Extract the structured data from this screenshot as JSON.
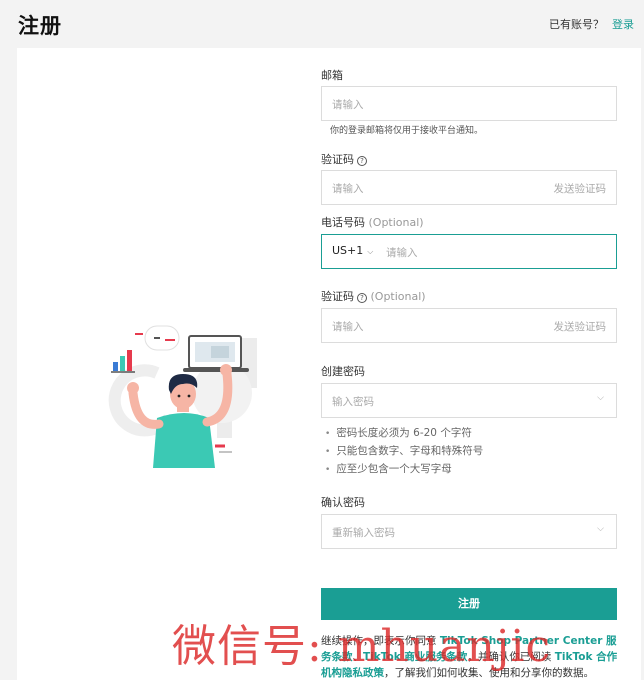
{
  "header": {
    "title": "注册",
    "has_account": "已有账号？",
    "login": "登录"
  },
  "form": {
    "email": {
      "label": "邮箱",
      "placeholder": "请输入",
      "hint": "你的登录邮箱将仅用于接收平台通知。"
    },
    "email_code": {
      "label": "验证码",
      "placeholder": "请输入",
      "send": "发送验证码"
    },
    "phone": {
      "label": "电话号码",
      "optional": "(Optional)",
      "country_code": "US+1",
      "placeholder": "请输入"
    },
    "phone_code": {
      "label": "验证码",
      "optional": "(Optional)",
      "placeholder": "请输入",
      "send": "发送验证码"
    },
    "password": {
      "label": "创建密码",
      "placeholder": "输入密码",
      "rules": [
        "密码长度必须为 6-20 个字符",
        "只能包含数字、字母和特殊符号",
        "应至少包含一个大写字母"
      ]
    },
    "confirm": {
      "label": "确认密码",
      "placeholder": "重新输入密码"
    },
    "submit": "注册",
    "terms": {
      "t1": "继续操作，即表示你同意 ",
      "l1": "TikTok Shop Partner Center 服务条款",
      "t2": "、",
      "l2": "TikTok 商业服务条款",
      "t3": "，并确认你已阅读 ",
      "l3": "TikTok 合作机构隐私政策",
      "t4": "，了解我们如何收集、使用和分享你的数据。"
    }
  },
  "watermark": "微信号: mhuanjic",
  "colors": {
    "accent": "#1a9e94",
    "watermark": "#dc2828"
  }
}
